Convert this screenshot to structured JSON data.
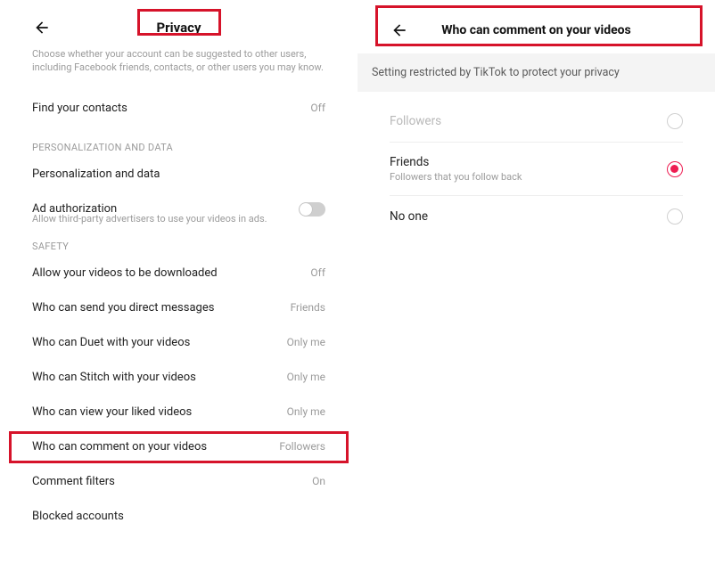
{
  "left": {
    "title": "Privacy",
    "topDescription": "Choose whether your account can be suggested to other users, including Facebook friends, contacts, or other users you may know.",
    "findContacts": {
      "label": "Find your contacts",
      "value": "Off"
    },
    "section_personalization_title": "PERSONALIZATION AND DATA",
    "personalizationRow": {
      "label": "Personalization and data"
    },
    "adAuth": {
      "label": "Ad authorization",
      "sub": "Allow third-party advertisers to use your videos in ads."
    },
    "section_safety_title": "SAFETY",
    "safety": {
      "download": {
        "label": "Allow your videos to be downloaded",
        "value": "Off"
      },
      "dm": {
        "label": "Who can send you direct messages",
        "value": "Friends"
      },
      "duet": {
        "label": "Who can Duet with your videos",
        "value": "Only me"
      },
      "stitch": {
        "label": "Who can Stitch with your videos",
        "value": "Only me"
      },
      "liked": {
        "label": "Who can view your liked videos",
        "value": "Only me"
      },
      "comment": {
        "label": "Who can comment on your videos",
        "value": "Followers"
      },
      "filters": {
        "label": "Comment filters",
        "value": "On"
      },
      "blocked": {
        "label": "Blocked accounts"
      }
    }
  },
  "right": {
    "title": "Who can comment on your videos",
    "banner": "Setting restricted by TikTok to protect your privacy",
    "options": {
      "followers": {
        "label": "Followers"
      },
      "friends": {
        "label": "Friends",
        "sub": "Followers that you follow back"
      },
      "noone": {
        "label": "No one"
      }
    }
  }
}
